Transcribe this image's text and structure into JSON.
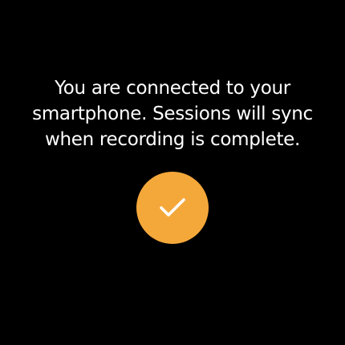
{
  "message": {
    "text": "You are connected to your smartphone. Sessions will sync when recording is complete."
  },
  "confirm": {
    "icon": "check-icon",
    "background_color": "#f5a83a",
    "icon_color": "#ffffff"
  },
  "theme": {
    "background": "#000000",
    "text_color": "#ffffff"
  }
}
